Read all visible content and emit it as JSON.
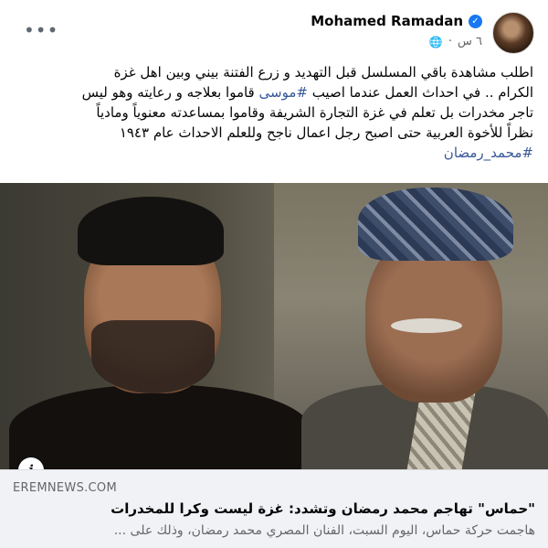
{
  "post": {
    "author": "Mohamed Ramadan",
    "time": "٦ س",
    "text_line1": "اطلب مشاهدة باقي المسلسل قبل التهديد و زرع الفتنة بيني وبين اهل غزة",
    "text_line2_a": "الكرام .. في احداث العمل عندما اصيب ",
    "text_line2_hashtag": "#موسى",
    "text_line2_b": " قاموا بعلاجه و رعايته وهو ليس",
    "text_line3": "تاجر مخدرات بل تعلم في غزة التجارة الشريفة وقاموا بمساعدته معنوياً ومادياً",
    "text_line4": "نظراً للأخوة العربية حتى اصبح رجل اعمال ناجح وللعلم الاحداث عام ١٩٤٣",
    "text_line5_hashtag": "#محمد_رمضان"
  },
  "link_preview": {
    "domain": "EREMNEWS.COM",
    "title": "\"حماس\" تهاجم محمد رمضان وتشدد: غزة ليست وكرا للمخدرات",
    "description": "هاجمت حركة حماس، اليوم السبت، الفنان المصري محمد رمضان، وذلك على ..."
  },
  "icons": {
    "verified": "verified-badge-icon",
    "globe": "globe-icon",
    "more": "more-options-icon",
    "info": "info-icon"
  },
  "colors": {
    "hashtag": "#385898",
    "verified": "#1877f2",
    "meta": "#65676b",
    "link_bg": "#f0f2f5"
  }
}
